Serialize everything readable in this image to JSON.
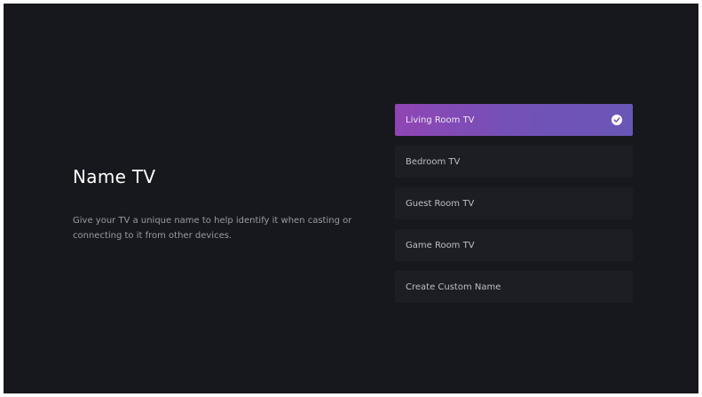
{
  "page": {
    "title": "Name TV",
    "description": "Give your TV a unique name to help identify it when casting or connecting to it from other devices."
  },
  "options": [
    {
      "label": "Living Room TV",
      "selected": true
    },
    {
      "label": "Bedroom TV",
      "selected": false
    },
    {
      "label": "Guest Room TV",
      "selected": false
    },
    {
      "label": "Game Room TV",
      "selected": false
    },
    {
      "label": "Create Custom Name",
      "selected": false
    }
  ],
  "colors": {
    "background": "#17181d",
    "selected_start": "#8f45b4",
    "selected_end": "#6a56b6",
    "option_bg": "#1d1e24"
  },
  "icons": {
    "selected_marker": "check-circle-icon"
  }
}
